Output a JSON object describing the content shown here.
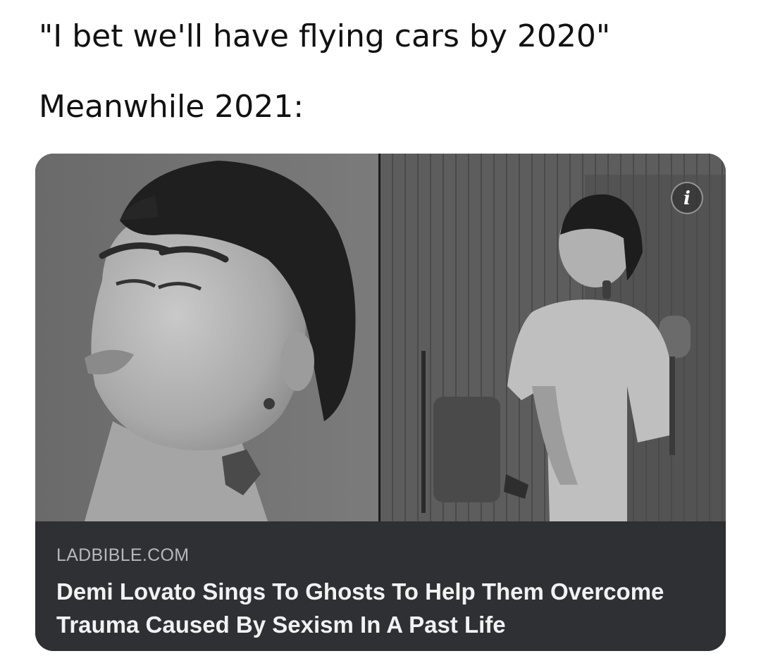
{
  "meme": {
    "line1": "\"I bet we'll have flying cars by 2020\"",
    "line2": "Meanwhile 2021:"
  },
  "card": {
    "source": "LADBIBLE.COM",
    "headline": "Demi Lovato Sings To Ghosts To Help Them Overcome Trauma Caused By Sexism In A Past Life",
    "info_glyph": "i",
    "info_icon": "info-icon"
  },
  "photos": {
    "left": "close-up-portrait",
    "right": "standing-in-room"
  }
}
